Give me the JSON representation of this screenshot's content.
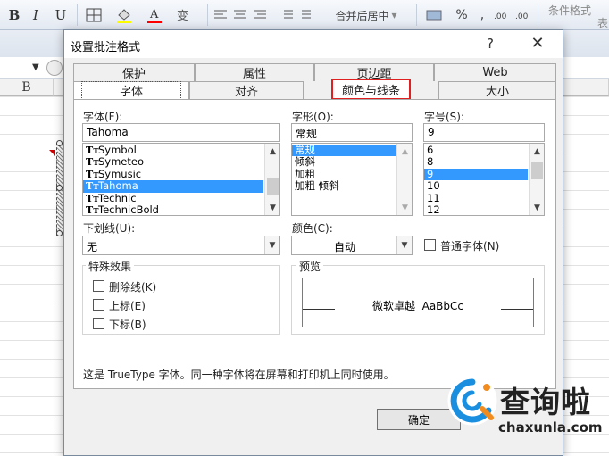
{
  "ribbon": {
    "bold": "B",
    "italic": "I",
    "underline": "U",
    "merge_center": "合并后居中",
    "percent": "%",
    "comma": ",",
    "conditional_format": "条件格式",
    "table": "表"
  },
  "sheet": {
    "column_b": "B"
  },
  "dialog": {
    "title": "设置批注格式",
    "help": "?",
    "close": "✕",
    "tabs_back": [
      "保护",
      "属性",
      "页边距",
      "Web"
    ],
    "tabs_front": [
      "字体",
      "对齐",
      "颜色与线条",
      "大小"
    ],
    "active_tab": "字体",
    "highlighted_tab": "颜色与线条",
    "font": {
      "label": "字体(F):",
      "value": "Tahoma",
      "items": [
        "Symbol",
        "Symeteo",
        "Symusic",
        "Tahoma",
        "Technic",
        "TechnicBold"
      ],
      "selected": "Tahoma"
    },
    "style": {
      "label": "字形(O):",
      "value": "常规",
      "items": [
        "常规",
        "倾斜",
        "加粗",
        "加粗 倾斜"
      ],
      "selected": "常规"
    },
    "size": {
      "label": "字号(S):",
      "value": "9",
      "items": [
        "6",
        "8",
        "9",
        "10",
        "11",
        "12"
      ],
      "selected": "9"
    },
    "underline": {
      "label": "下划线(U):",
      "value": "无"
    },
    "color": {
      "label": "颜色(C):",
      "value": "自动"
    },
    "normal_font": {
      "label": "普通字体(N)",
      "checked": false
    },
    "effects": {
      "title": "特殊效果",
      "strikethrough": "删除线(K)",
      "superscript": "上标(E)",
      "subscript": "下标(B)"
    },
    "preview": {
      "title": "预览",
      "text": "微软卓越  AaBbCc"
    },
    "info": "这是 TrueType 字体。同一种字体将在屏幕和打印机上同时使用。",
    "ok": "确定"
  },
  "watermark": {
    "name": "查询啦",
    "url": "chaxunla.com"
  },
  "colors": {
    "selection": "#3399ff",
    "highlight_border": "#e02020",
    "watermark_blue": "#1a8fe0"
  }
}
